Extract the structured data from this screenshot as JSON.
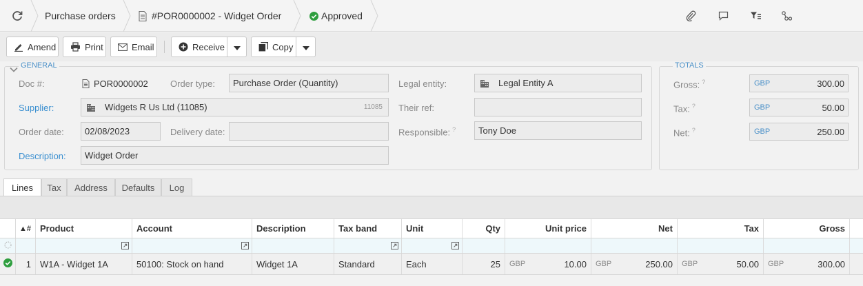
{
  "breadcrumb": {
    "section": "Purchase orders",
    "document": "#POR0000002 - Widget Order",
    "status": "Approved"
  },
  "top_icons": [
    "refresh-icon",
    "paperclip-icon",
    "comment-icon",
    "filter-list-icon",
    "share-icon"
  ],
  "toolbar": {
    "amend": "Amend",
    "print": "Print",
    "email": "Email",
    "receive": "Receive",
    "copy": "Copy"
  },
  "general": {
    "legend": "GENERAL",
    "doc_label": "Doc #:",
    "doc_value": "POR0000002",
    "order_type_label": "Order type:",
    "order_type_value": "Purchase Order (Quantity)",
    "legal_entity_label": "Legal entity:",
    "legal_entity_value": "Legal Entity A",
    "supplier_label": "Supplier:",
    "supplier_value": "Widgets R Us Ltd (11085)",
    "supplier_code": "11085",
    "their_ref_label": "Their ref:",
    "their_ref_value": "",
    "order_date_label": "Order date:",
    "order_date_value": "02/08/2023",
    "delivery_date_label": "Delivery date:",
    "delivery_date_value": "",
    "responsible_label": "Responsible:",
    "responsible_value": "Tony Doe",
    "description_label": "Description:",
    "description_value": "Widget Order"
  },
  "totals": {
    "legend": "TOTALS",
    "gross_label": "Gross:",
    "gross_currency": "GBP",
    "gross_value": "300.00",
    "tax_label": "Tax:",
    "tax_currency": "GBP",
    "tax_value": "50.00",
    "net_label": "Net:",
    "net_currency": "GBP",
    "net_value": "250.00"
  },
  "tabs": [
    "Lines",
    "Tax",
    "Address",
    "Defaults",
    "Log"
  ],
  "grid": {
    "headers": {
      "sort": "▲#",
      "product": "Product",
      "account": "Account",
      "description": "Description",
      "tax_band": "Tax band",
      "unit": "Unit",
      "qty": "Qty",
      "unit_price": "Unit price",
      "net": "Net",
      "tax": "Tax",
      "gross": "Gross"
    },
    "rows": [
      {
        "num": "1",
        "product": "W1A - Widget 1A",
        "account": "50100: Stock on hand",
        "description": "Widget 1A",
        "tax_band": "Standard",
        "unit": "Each",
        "qty": "25",
        "unit_price_currency": "GBP",
        "unit_price": "10.00",
        "net_currency": "GBP",
        "net": "250.00",
        "tax_currency": "GBP",
        "tax": "50.00",
        "gross_currency": "GBP",
        "gross": "300.00"
      }
    ]
  },
  "colors": {
    "link": "#3a8fd0",
    "approved": "#2e9e3e"
  }
}
